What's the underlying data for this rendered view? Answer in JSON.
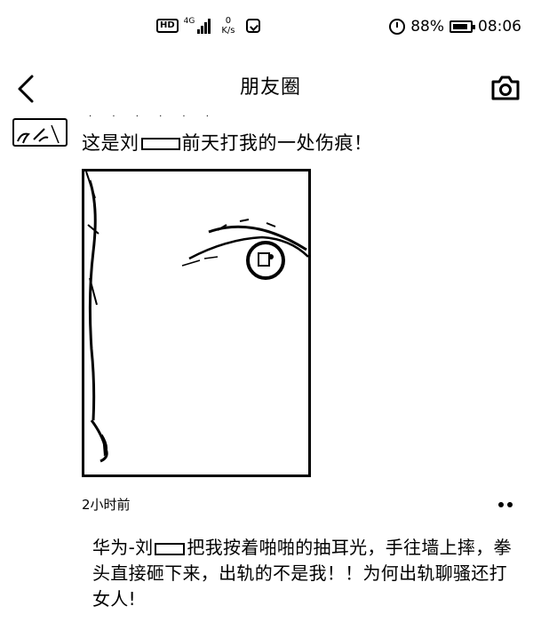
{
  "status_bar": {
    "hd_badge": "HD",
    "network_gen": "4G",
    "speed_value": "0",
    "speed_unit": "K/s",
    "battery": "88%",
    "battery_level": 0.88,
    "time": "08:06"
  },
  "nav": {
    "title": "朋友圈",
    "back_icon": "chevron-left-icon",
    "camera_icon": "camera-icon"
  },
  "post": {
    "text_before": "这是刘",
    "text_after": "前天打我的一处伤痕！",
    "timestamp": "2小时前",
    "more_icon": "more-dots-icon"
  },
  "comment": {
    "prefix": "华为-刘",
    "body": "把我按着啪啪的抽耳光，手往墙上摔，拳头直接砸下来，出轨的不是我！！为何出轨聊骚还打女人!"
  }
}
